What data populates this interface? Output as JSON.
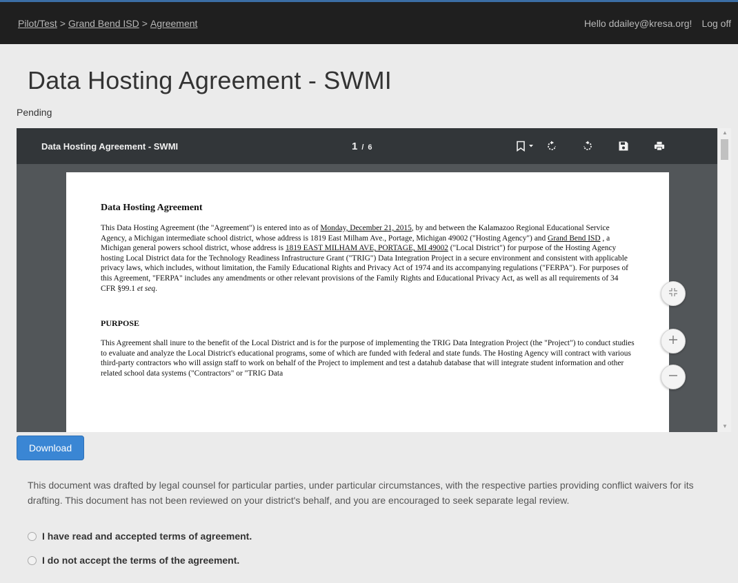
{
  "breadcrumb": {
    "items": [
      "Pilot/Test",
      "Grand Bend ISD",
      "Agreement"
    ],
    "separator": ">"
  },
  "user": {
    "greeting": "Hello ddailey@kresa.org!",
    "logoff_label": "Log off"
  },
  "page": {
    "title": "Data Hosting Agreement - SWMI",
    "status": "Pending"
  },
  "viewer": {
    "doc_title": "Data Hosting Agreement - SWMI",
    "current_page": "1",
    "page_separator": "/",
    "total_pages": "6",
    "icons": [
      "bookmark-icon",
      "rotate-clockwise-icon",
      "rotate-counterclockwise-icon",
      "save-icon",
      "print-icon"
    ]
  },
  "document": {
    "heading": "Data Hosting Agreement",
    "intro": {
      "t1": "This Data Hosting Agreement (the \"Agreement\") is entered into as of ",
      "date": "Monday, December 21, 2015",
      "t2": ", by and between the Kalamazoo Regional Educational Service Agency, a Michigan intermediate school district, whose address is 1819 East Milham Ave., Portage, Michigan 49002 (\"Hosting Agency\") and ",
      "district": "Grand Bend ISD",
      "t3": " , a Michigan general powers school district, whose address is ",
      "address": "1819 EAST MILHAM AVE, PORTAGE, MI 49002",
      "t4": " (\"Local District\") for purpose of the Hosting Agency hosting Local District data for the Technology Readiness Infrastructure Grant (\"TRIG\") Data Integration Project in a secure environment and consistent with applicable privacy laws, which includes, without limitation, the Family Educational Rights and Privacy Act of 1974 and its accompanying regulations (\"FERPA\"). For purposes of this Agreement, \"FERPA\" includes any amendments or other relevant provisions of the Family Rights and Educational Privacy Act, as well as all requirements of 34 CFR §99.1 ",
      "etseq": "et seq",
      "t5": "."
    },
    "purpose_heading": "PURPOSE",
    "purpose_text": "This Agreement shall inure to the benefit of the Local District and is for the purpose of implementing the TRIG Data Integration Project (the \"Project\") to conduct studies to evaluate and analyze the Local District's educational programs, some of which are funded with federal and state funds. The Hosting Agency will contract with various third-party contractors who will assign staff to work on behalf of the Project to implement and test a datahub database that will integrate student information and other related school data systems (\"Contractors\" or \"TRIG Data"
  },
  "zoom_controls": {
    "fit_icon": "fit-to-page-icon",
    "zoom_in_icon": "plus-icon",
    "zoom_out_icon": "minus-icon"
  },
  "actions": {
    "download_label": "Download"
  },
  "disclaimer": "This document was drafted by legal counsel for particular parties, under particular circumstances, with the respective parties providing conflict waivers for its drafting. This document has not been reviewed on your district's behalf, and you are encouraged to seek separate legal review.",
  "options": {
    "accept_label": "I have read and accepted terms of agreement.",
    "decline_label": "I do not accept the terms of the agreement."
  },
  "colors": {
    "topbar": "#1f1f1f",
    "viewer_bg": "#525659",
    "viewer_toolbar": "#323639",
    "primary_button": "#3a86d4",
    "page_bg": "#ebebeb"
  }
}
